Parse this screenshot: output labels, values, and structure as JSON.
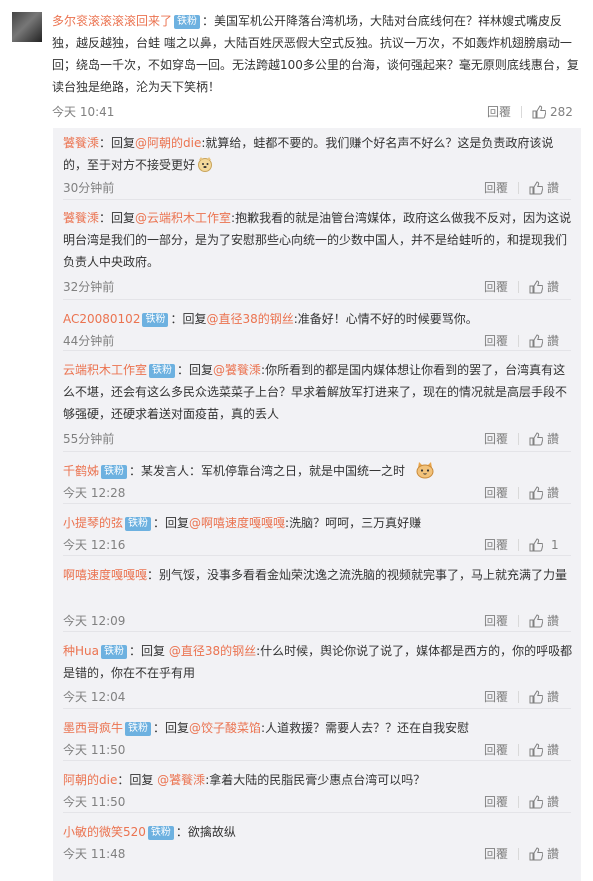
{
  "main_comment": {
    "author": "多尔衮滚滚滚滚回来了",
    "badge": "铁粉",
    "text": "：美国军机公开降落台湾机场，大陆对台底线何在？祥林嫂式嘴皮反独，越反越独，台蛙 嗤之以鼻，大陆百姓厌恶假大空式反独。抗议一万次，不如轰炸机翅膀扇动一回；绕岛一千次，不如穿岛一回。无法跨越100多公里的台海，谈何强起来？毫无原则底线惠台，复读台独是绝路，沦为天下笑柄！",
    "time": "今天 10:41",
    "reply_label": "回覆",
    "like_count": "282"
  },
  "replies": [
    {
      "author": "饕餮溗",
      "badge": "",
      "prefix": "：回复",
      "target": "@阿朝的die",
      "text": ":就算给，蛙都不要的。我们赚个好名声不好么？这是负责政府该说的，至于对方不接受更好",
      "emoji": "doge-emoji",
      "time": "30分钟前",
      "reply_label": "回覆",
      "like": "讚"
    },
    {
      "author": "饕餮溗",
      "badge": "",
      "prefix": "：回复",
      "target": "@云端积木工作室",
      "text": ":抱歉我看的就是油管台湾媒体，政府这么做我不反对，因为这说明台湾是我们的一部分，是为了安慰那些心向统一的少数中国人，并不是给蛙听的，和提现我们负责人中央政府。",
      "emoji": "",
      "time": "32分钟前",
      "reply_label": "回覆",
      "like": "讚"
    },
    {
      "author": "AC20080102",
      "badge": "铁粉",
      "prefix": "：回复",
      "target": "@直径38的钢丝",
      "text": ":准备好！心情不好的时候要骂你。",
      "emoji": "",
      "time": "44分钟前",
      "reply_label": "回覆",
      "like": "讚"
    },
    {
      "author": "云端积木工作室",
      "badge": "铁粉",
      "prefix": "：回复",
      "target": "@饕餮溗",
      "text": ":你所看到的都是国内媒体想让你看到的罢了，台湾真有这么不堪，还会有这么多民众选菜菜子上台？早求着解放军打进来了，现在的情况就是高层手段不够强硬，还硬求着送对面疫苗，真的丢人",
      "emoji": "",
      "time": "55分钟前",
      "reply_label": "回覆",
      "like": "讚"
    },
    {
      "author": "千鹤姊",
      "badge": "铁粉",
      "prefix": "：某发言人：",
      "target": "",
      "text": "军机停靠台湾之日，就是中国统一之时",
      "emoji": "cat-emoji",
      "time": "今天 12:28",
      "reply_label": "回覆",
      "like": "讚"
    },
    {
      "author": "小提琴的弦",
      "badge": "铁粉",
      "prefix": "：回复",
      "target": "@啊嘻速度嘎嘎嘎",
      "text": ":洗脑？呵呵，三万真好赚",
      "emoji": "",
      "time": "今天 12:16",
      "reply_label": "回覆",
      "like": "1"
    },
    {
      "author": "啊嘻速度嘎嘎嘎",
      "badge": "",
      "prefix": "：别气馁，没事多看看金灿荣沈逸之流洗脑的视频就完事了，马上就充满了力量",
      "target": "",
      "text": "",
      "emoji": "",
      "time": "今天 12:09",
      "reply_label": "回覆",
      "like": "讚"
    },
    {
      "author": "种Hua",
      "badge": "铁粉",
      "prefix": "：回复 ",
      "target": "@直径38的钢丝",
      "text": ":什么时候，舆论你说了说了，媒体都是西方的，你的呼吸都是错的，你在不在乎有用",
      "emoji": "",
      "time": "今天 12:04",
      "reply_label": "回覆",
      "like": "讚"
    },
    {
      "author": "墨西哥疯牛",
      "badge": "铁粉",
      "prefix": "：回复",
      "target": "@饺子酸菜馅",
      "text": ":人道救援？需要人去？？还在自我安慰",
      "emoji": "",
      "time": "今天 11:50",
      "reply_label": "回覆",
      "like": "讚"
    },
    {
      "author": "阿朝的die",
      "badge": "",
      "prefix": "：回复 ",
      "target": "@饕餮溗",
      "text": ":拿着大陆的民脂民膏少惠点台湾可以吗？",
      "emoji": "",
      "time": "今天 11:50",
      "reply_label": "回覆",
      "like": "讚"
    },
    {
      "author": "小敏的微笑520",
      "badge": "铁粉",
      "prefix": "：欲擒故纵",
      "target": "",
      "text": "",
      "emoji": "",
      "time": "今天 11:48",
      "reply_label": "回覆",
      "like": "讚"
    }
  ],
  "colors": {
    "username": "#eb7350",
    "badge_bg": "#6db1e0",
    "reply_bg": "#f2f2f5",
    "meta": "#808080"
  },
  "icons": {
    "like": "thumbs-up-icon"
  }
}
